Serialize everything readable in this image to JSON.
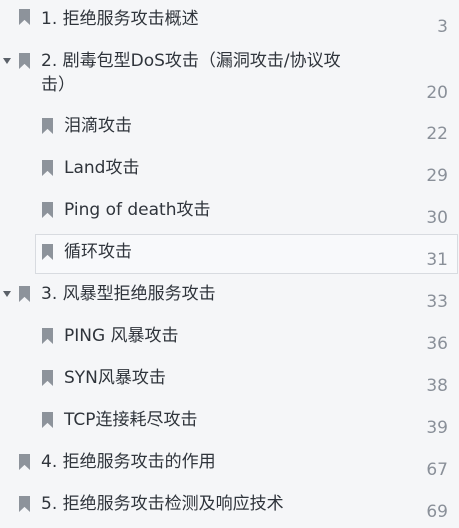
{
  "toc": {
    "items": [
      {
        "title": "1. 拒绝服务攻击概述",
        "page": "3"
      },
      {
        "title": "2. 剧毒包型DoS攻击（漏洞攻击/协议攻击）",
        "page": "20"
      },
      {
        "title": "泪滴攻击",
        "page": "22"
      },
      {
        "title": "Land攻击",
        "page": "29"
      },
      {
        "title": "Ping of death攻击",
        "page": "30"
      },
      {
        "title": "循环攻击",
        "page": "31"
      },
      {
        "title": "3. 风暴型拒绝服务攻击",
        "page": "33"
      },
      {
        "title": "PING 风暴攻击",
        "page": "36"
      },
      {
        "title": "SYN风暴攻击",
        "page": "38"
      },
      {
        "title": "TCP连接耗尽攻击",
        "page": "39"
      },
      {
        "title": "4. 拒绝服务攻击的作用",
        "page": "67"
      },
      {
        "title": "5. 拒绝服务攻击检测及响应技术",
        "page": "69"
      }
    ]
  }
}
